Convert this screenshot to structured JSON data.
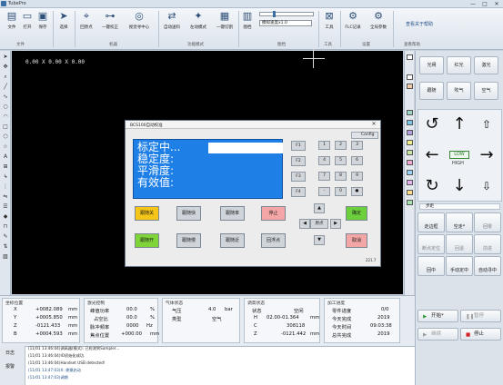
{
  "window": {
    "title": "TubePro",
    "min": "—",
    "max": "□",
    "close": "✕"
  },
  "ribbon": {
    "buttons": [
      {
        "label": "文件",
        "icon": "document-icon",
        "glyph": "▤"
      },
      {
        "label": "打开",
        "icon": "folder-open-icon",
        "glyph": "▭"
      },
      {
        "label": "保存",
        "icon": "save-icon",
        "glyph": "▣"
      },
      {
        "label": "选择",
        "icon": "pointer-icon",
        "glyph": "➤"
      },
      {
        "label": "回原点",
        "icon": "home-origin-icon",
        "glyph": "⌖"
      },
      {
        "label": "一键校正",
        "icon": "calibrate-icon",
        "glyph": "⊶"
      },
      {
        "label": "视觉寻中心",
        "icon": "vision-center-icon",
        "glyph": "◎"
      },
      {
        "label": "自动送料",
        "icon": "auto-feed-icon",
        "glyph": "⇄"
      },
      {
        "label": "左动模式",
        "icon": "mode-icon",
        "glyph": "✦"
      },
      {
        "label": "一键切割",
        "icon": "cut-icon",
        "glyph": "▦"
      },
      {
        "label": "图档",
        "icon": "drawing-icon",
        "glyph": "▥"
      },
      {
        "label": "工具",
        "icon": "tool-icon",
        "glyph": "⊠"
      },
      {
        "label": "FLC记录",
        "icon": "record-icon",
        "glyph": "⚙"
      },
      {
        "label": "全局参数",
        "icon": "settings-icon",
        "glyph": "⚙"
      }
    ],
    "groups": [
      "文件",
      "机器",
      "功能模式",
      "图档",
      "工具",
      "设置",
      "查看帮助"
    ],
    "slider_label": "模拟速度x1.0",
    "help_link": "查看关于帮助"
  },
  "canvas": {
    "coords": "0.00 X 0.00 X 0.00"
  },
  "dialog": {
    "title": "BCS100自动校准",
    "config_label": "Config",
    "lcd_lines": [
      "标定中...",
      "稳定度:",
      "平滑度:",
      "有效值:"
    ],
    "fkeys": [
      "F1",
      "F2",
      "F3",
      "F4"
    ],
    "numkeys": [
      "1",
      "2",
      "3",
      "4",
      "5",
      "6",
      "7",
      "8",
      "9",
      "-",
      "0",
      "●"
    ],
    "action_keys": [
      {
        "label": "跟随关",
        "color": "#f5c518"
      },
      {
        "label": "跟随快",
        "color": "#cfd4da"
      },
      {
        "label": "跟随开",
        "color": "#7fd43a"
      },
      {
        "label": "跟随慢",
        "color": "#cfd4da"
      },
      {
        "label": "跟随率",
        "color": "#cfd4da"
      },
      {
        "label": "跟随近",
        "color": "#cfd4da"
      },
      {
        "label": "停止",
        "color": "#f4a6a6"
      },
      {
        "label": "回浮点",
        "color": "#cfd4da"
      },
      {
        "label": "确定",
        "color": "#6ccf3c"
      },
      {
        "label": "取消",
        "color": "#f4a6a6"
      }
    ],
    "nav": {
      "up": "▲",
      "down": "▼",
      "left": "◀",
      "right": "▶",
      "center": "原点"
    },
    "version": "221.7"
  },
  "status": {
    "axis": {
      "title": "坐标位置",
      "rows": [
        {
          "name": "X",
          "value": "+0082.089",
          "unit": "mm"
        },
        {
          "name": "Y",
          "value": "+0005.850",
          "unit": "mm"
        },
        {
          "name": "Z",
          "value": "-0121.433",
          "unit": "mm"
        },
        {
          "name": "B",
          "value": "+0004.593",
          "unit": "mm"
        }
      ]
    },
    "laser": {
      "title": "激光控制",
      "rows": [
        {
          "name": "峰值功率",
          "value": "00.0",
          "unit": "%"
        },
        {
          "name": "占空比",
          "value": "00.0",
          "unit": "%"
        },
        {
          "name": "脉冲频率",
          "value": "0000",
          "unit": "Hz"
        },
        {
          "name": "焦点位置",
          "value": "+000.00",
          "unit": "mm"
        }
      ]
    },
    "gas": {
      "title": "气体状态",
      "rows": [
        {
          "name": "气压",
          "value": "4.0",
          "unit": "bar"
        },
        {
          "name": "类型",
          "value": "空气",
          "unit": ""
        }
      ]
    },
    "follow": {
      "title": "调高状态",
      "rows": [
        {
          "name": "状态",
          "value": "空闲"
        },
        {
          "name": "H",
          "value": "02.00-01.364",
          "unit": "mm"
        },
        {
          "name": "C",
          "value": "308118",
          "unit": ""
        },
        {
          "name": "Z",
          "value": "-0121.442",
          "unit": "mm"
        }
      ]
    },
    "process": {
      "title": "加工进度",
      "rows": [
        {
          "name": "零件进度",
          "value": "0/0"
        },
        {
          "name": "今天完成",
          "value": "2019"
        },
        {
          "name": "今天时间",
          "value": "09:03:38"
        },
        {
          "name": "总共完成",
          "value": "2019"
        }
      ]
    }
  },
  "log": {
    "tabs": [
      "日志",
      "报警"
    ],
    "lines": [
      "(11/01 13:46:04)调高器(模式): 已检测到Sampler...",
      "(11/01 13:46:04)IO初始化成功.",
      "(11/01 13:46:04)Handset USB detected!",
      "(11/01 13:47:03)X: 便捷启动",
      "(11/01 13:47:03)调期"
    ]
  },
  "right_panel": {
    "top_buttons": [
      "光闸",
      "红光",
      "激光",
      "跟随",
      "吹气",
      "空气"
    ],
    "speed_low": "LOW",
    "speed_high": "HIGH",
    "step_label": "步距",
    "mid_buttons": [
      "走边框",
      "空走*",
      "回零",
      "断点定位",
      "回退",
      "前进",
      "回中",
      "手动定中",
      "自动寻中"
    ],
    "start": "开始*",
    "pause": "暂停",
    "resume": "继续",
    "stop": "停止"
  },
  "colors": {
    "lcd": "#1e7fe6",
    "canvas": "#000000",
    "accent": "#2e4f78",
    "start": "#2e9b3a",
    "stop": "#d32222"
  }
}
